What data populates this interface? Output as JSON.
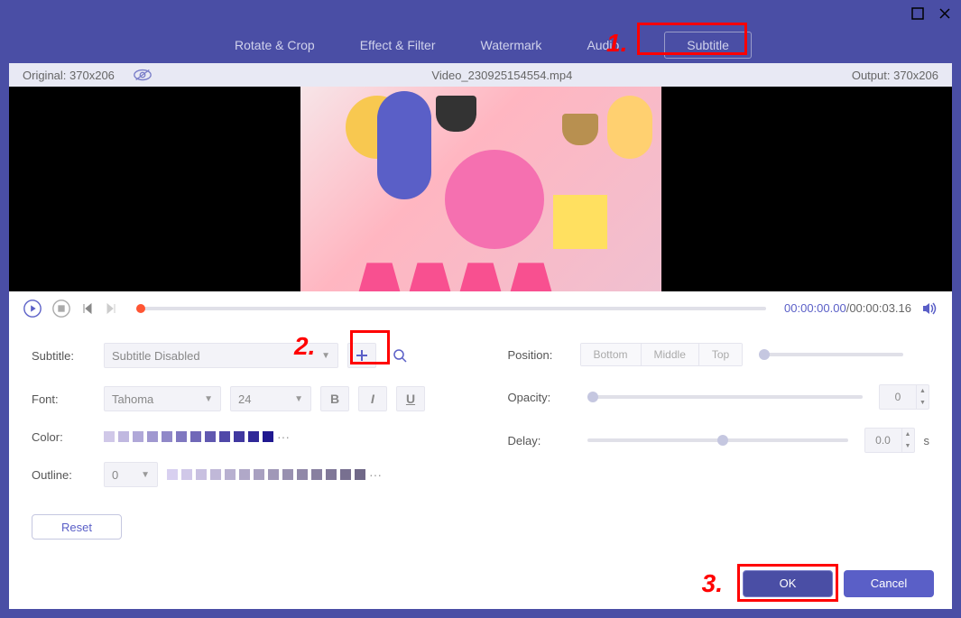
{
  "tabs": {
    "rotate": "Rotate & Crop",
    "effect": "Effect & Filter",
    "watermark": "Watermark",
    "audio": "Audio",
    "subtitle": "Subtitle"
  },
  "annotations": {
    "a1": "1.",
    "a2": "2.",
    "a3": "3."
  },
  "info": {
    "original": "Original: 370x206",
    "filename": "Video_230925154554.mp4",
    "output": "Output: 370x206"
  },
  "playback": {
    "current": "00:00:00.00",
    "total": "/00:00:03.16"
  },
  "labels": {
    "subtitle": "Subtitle:",
    "font": "Font:",
    "color": "Color:",
    "outline": "Outline:",
    "position": "Position:",
    "opacity": "Opacity:",
    "delay": "Delay:"
  },
  "values": {
    "subtitle_select": "Subtitle Disabled",
    "font_name": "Tahoma",
    "font_size": "24",
    "outline_size": "0",
    "opacity": "0",
    "delay": "0.0",
    "delay_unit": "s"
  },
  "position": {
    "bottom": "Bottom",
    "middle": "Middle",
    "top": "Top"
  },
  "buttons": {
    "reset": "Reset",
    "ok": "OK",
    "cancel": "Cancel"
  },
  "style_btns": {
    "bold": "B",
    "italic": "I",
    "underline": "U"
  },
  "color_swatches": [
    "#d0c8e8",
    "#c0b8e0",
    "#b0a8d8",
    "#a098d0",
    "#9088c8",
    "#8078c0",
    "#7068b8",
    "#6058b0",
    "#5048a8",
    "#4038a0",
    "#302898",
    "#201890"
  ],
  "outline_swatches": [
    "#d8d0f0",
    "#d0c8e8",
    "#c8c0e0",
    "#c0b8d8",
    "#b8b0d0",
    "#b0a8c8",
    "#a8a0c0",
    "#a098b8",
    "#9890b0",
    "#9088a8",
    "#8880a0",
    "#807898",
    "#787090",
    "#706888"
  ]
}
